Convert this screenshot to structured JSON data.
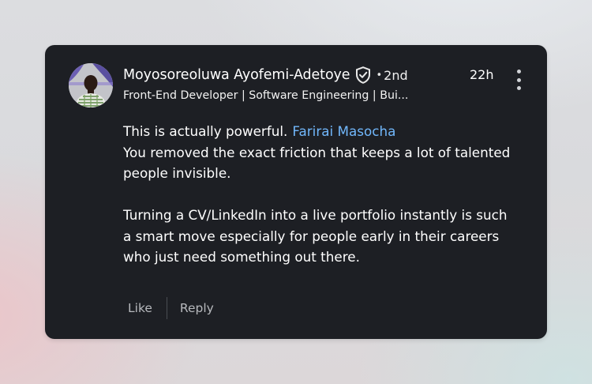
{
  "comment": {
    "author": {
      "name": "Moyosoreoluwa Ayofemi-Adetoye",
      "verified_icon": "shield-check-icon",
      "connection_degree": "2nd",
      "headline": "Front-End Developer | Software Engineering | Bui...",
      "avatar": "profile-photo"
    },
    "timestamp": "22h",
    "menu_icon": "vertical-ellipsis-icon",
    "body": {
      "line1_text": "This is actually powerful.",
      "mention": "Farirai Masocha",
      "line2_text": "You removed the exact friction that keeps a lot of talented people invisible.",
      "paragraph2": "Turning a CV/LinkedIn into a live portfolio instantly is such a smart move especially for people early in their careers who just need something out there."
    },
    "actions": {
      "like_label": "Like",
      "reply_label": "Reply"
    }
  },
  "colors": {
    "card_bg": "#1d1f24",
    "text_primary": "#ffffff",
    "mention": "#71b7fb",
    "action_text": "#b7b9bd"
  }
}
